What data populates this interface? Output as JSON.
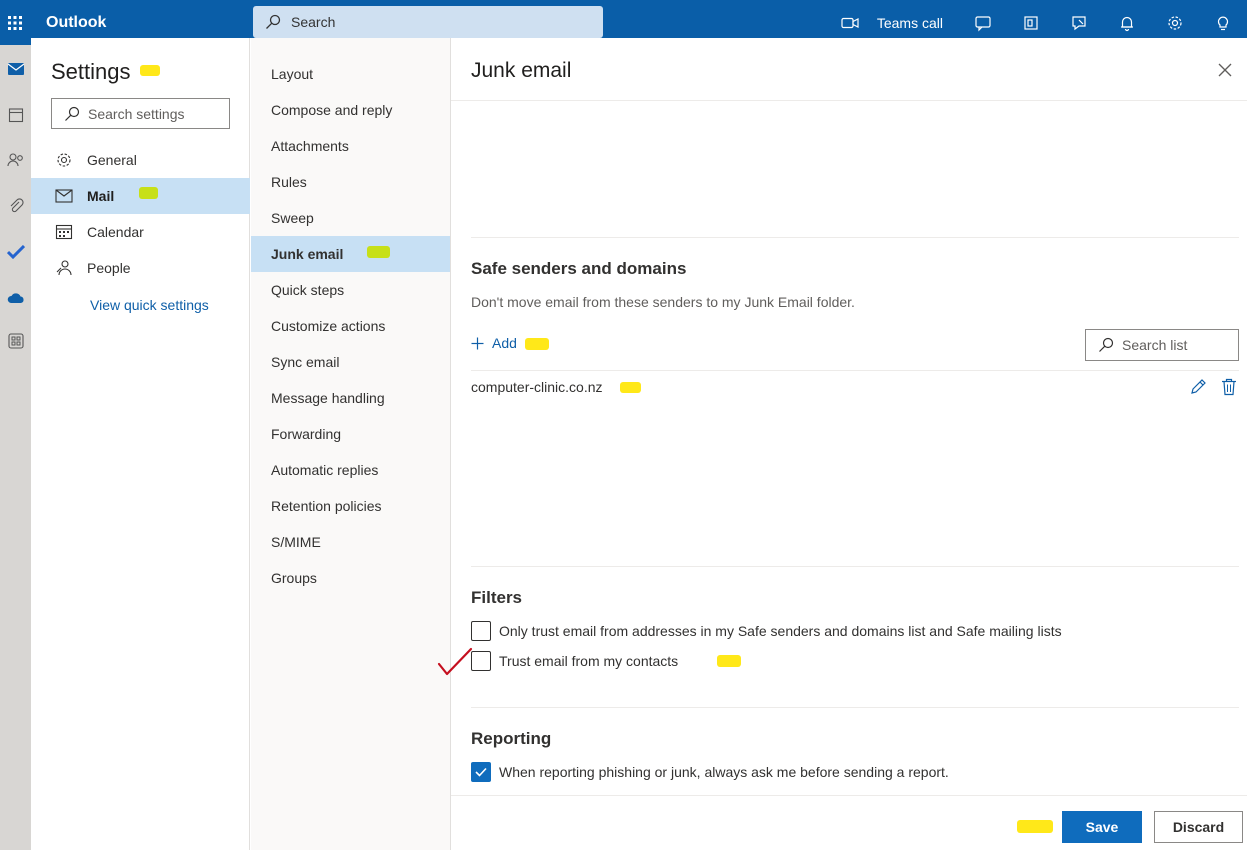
{
  "app": {
    "title": "Outlook",
    "search_placeholder": "Search"
  },
  "topbar": {
    "teams_call_label": "Teams call"
  },
  "settings": {
    "title": "Settings",
    "search_placeholder": "Search settings",
    "categories": [
      {
        "label": "General",
        "icon": "gear-icon"
      },
      {
        "label": "Mail",
        "icon": "mail-icon",
        "selected": true
      },
      {
        "label": "Calendar",
        "icon": "calendar-icon"
      },
      {
        "label": "People",
        "icon": "people-icon"
      }
    ],
    "view_quick_settings": "View quick settings"
  },
  "mail_sections": [
    "Layout",
    "Compose and reply",
    "Attachments",
    "Rules",
    "Sweep",
    "Junk email",
    "Quick steps",
    "Customize actions",
    "Sync email",
    "Message handling",
    "Forwarding",
    "Automatic replies",
    "Retention policies",
    "S/MIME",
    "Groups"
  ],
  "selected_section": "Junk email",
  "junk": {
    "title": "Junk email",
    "safe_senders": {
      "title": "Safe senders and domains",
      "description": "Don't move email from these senders to my Junk Email folder.",
      "add_label": "Add",
      "search_placeholder": "Search list",
      "entries": [
        "computer-clinic.co.nz"
      ]
    },
    "filters": {
      "title": "Filters",
      "only_trust_label": "Only trust email from addresses in my Safe senders and domains list and Safe mailing lists",
      "only_trust_checked": false,
      "trust_contacts_label": "Trust email from my contacts",
      "trust_contacts_checked": false
    },
    "reporting": {
      "title": "Reporting",
      "ask_label": "When reporting phishing or junk, always ask me before sending a report.",
      "ask_checked": true
    }
  },
  "footer": {
    "save_label": "Save",
    "discard_label": "Discard"
  },
  "colors": {
    "brand": "#0f6cbd",
    "highlight": "#ffe600",
    "selected_bg": "#c7e0f4",
    "check_mark": "#c50f1f"
  }
}
